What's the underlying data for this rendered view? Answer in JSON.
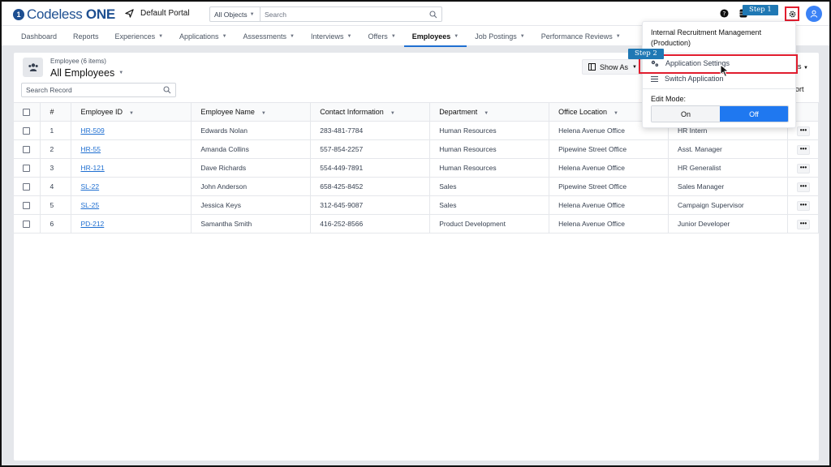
{
  "header": {
    "logo_text_1": "Codeless",
    "logo_text_2": "ONE",
    "portal_label": "Default Portal",
    "search_scope": "All Objects",
    "search_placeholder": "Search"
  },
  "annotations": {
    "step1": "Step 1",
    "step2": "Step 2"
  },
  "nav": {
    "tabs": [
      {
        "label": "Dashboard"
      },
      {
        "label": "Reports"
      },
      {
        "label": "Experiences"
      },
      {
        "label": "Applications"
      },
      {
        "label": "Assessments"
      },
      {
        "label": "Interviews"
      },
      {
        "label": "Offers"
      },
      {
        "label": "Employees"
      },
      {
        "label": "Job Postings"
      },
      {
        "label": "Performance Reviews"
      }
    ]
  },
  "list": {
    "count_label": "Employee (6 items)",
    "view_title": "All Employees",
    "search_placeholder": "Search Record",
    "show_as_label": "Show As",
    "actions_partial": "s",
    "export_partial": "port"
  },
  "table": {
    "columns": {
      "index": "#",
      "employee_id": "Employee ID",
      "employee_name": "Employee Name",
      "contact": "Contact Information",
      "department": "Department",
      "office": "Office Location"
    },
    "rows": [
      {
        "n": "1",
        "id": "HR-509",
        "name": "Edwards Nolan",
        "contact": "283-481-7784",
        "dept": "Human Resources",
        "office": "Helena Avenue Office",
        "title": "HR Intern"
      },
      {
        "n": "2",
        "id": "HR-55",
        "name": "Amanda Collins",
        "contact": "557-854-2257",
        "dept": "Human Resources",
        "office": "Pipewine Street Office",
        "title": "Asst. Manager"
      },
      {
        "n": "3",
        "id": "HR-121",
        "name": "Dave Richards",
        "contact": "554-449-7891",
        "dept": "Human Resources",
        "office": "Helena Avenue Office",
        "title": "HR Generalist"
      },
      {
        "n": "4",
        "id": "SL-22",
        "name": "John Anderson",
        "contact": "658-425-8452",
        "dept": "Sales",
        "office": "Pipewine Street Office",
        "title": "Sales Manager"
      },
      {
        "n": "5",
        "id": "SL-25",
        "name": "Jessica Keys",
        "contact": "312-645-9087",
        "dept": "Sales",
        "office": "Helena Avenue Office",
        "title": "Campaign Supervisor"
      },
      {
        "n": "6",
        "id": "PD-212",
        "name": "Samantha Smith",
        "contact": "416-252-8566",
        "dept": "Product Development",
        "office": "Helena Avenue Office",
        "title": "Junior Developer"
      }
    ],
    "more_label": "•••"
  },
  "dropdown": {
    "app_name": "Internal Recruitment Management (Production)",
    "settings_label": "Application Settings",
    "switch_label": "Switch Application",
    "edit_mode_label": "Edit Mode:",
    "on_label": "On",
    "off_label": "Off"
  },
  "colors": {
    "accent": "#1f78f0",
    "annotation_red": "#e11d2e",
    "step_tag": "#1f78b4"
  }
}
